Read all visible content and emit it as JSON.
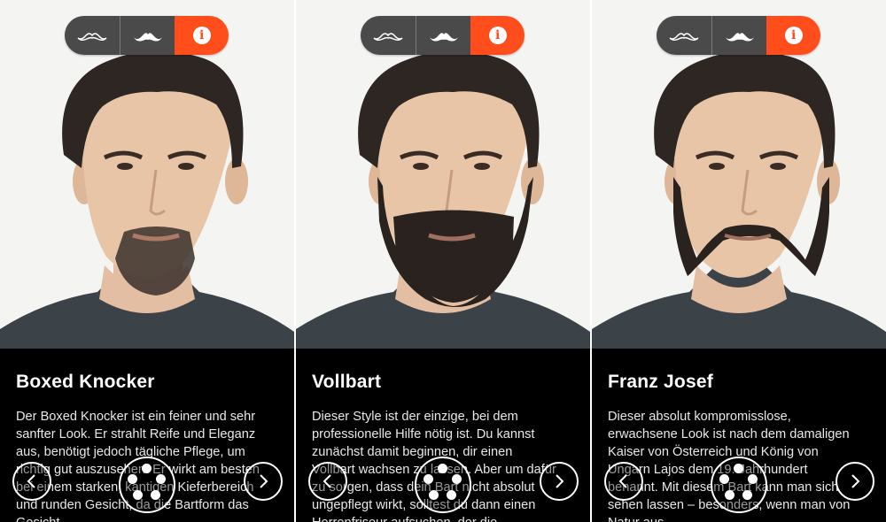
{
  "panels": [
    {
      "title": "Boxed Knocker",
      "description": "Der Boxed Knocker ist ein feiner und sehr sanfter Look. Er strahlt Reife und Eleganz aus, benötigt jedoch tägliche Pflege, um richtig gut auszusehen. Er wirkt am besten bei einem starken, kantigen Kieferbereich und runden Gesicht, da die Bartform das Gesicht",
      "beard_style": "goatee-boxed"
    },
    {
      "title": "Vollbart",
      "description": "Dieser Style ist der einzige, bei dem professionelle Hilfe nötig ist. Du kannst zunächst damit beginnen, dir einen Vollbart wachsen zu lassen. Aber um dafür zu sorgen, dass dein Bart nicht absolut ungepflegt wirkt, solltest du dann einen Herrenfriseur aufsuchen, der die",
      "beard_style": "full-beard"
    },
    {
      "title": "Franz Josef",
      "description": "Dieser absolut kompromisslose, erwachsene Look ist nach dem damaligen Kaiser von Österreich und König von Ungarn Lajos dem 19. Jahrhundert benannt. Mit diesem Bart kann man sich sehen lassen – besonders, wenn man von Natur aus",
      "beard_style": "mutton-chops"
    }
  ],
  "toggle": {
    "options": [
      "mustache-thin-icon",
      "mustache-bold-icon",
      "info-icon"
    ],
    "selected": "info-icon",
    "info_glyph": "i"
  },
  "nav": {
    "prev_icon": "chevron-left-icon",
    "next_icon": "chevron-right-icon",
    "center_icon": "five-dots-icon"
  },
  "colors": {
    "accent": "#ff4e1c",
    "toggle_bg": "#4a4a4a",
    "text_panel_bg": "#000000",
    "text": "#ffffff"
  }
}
